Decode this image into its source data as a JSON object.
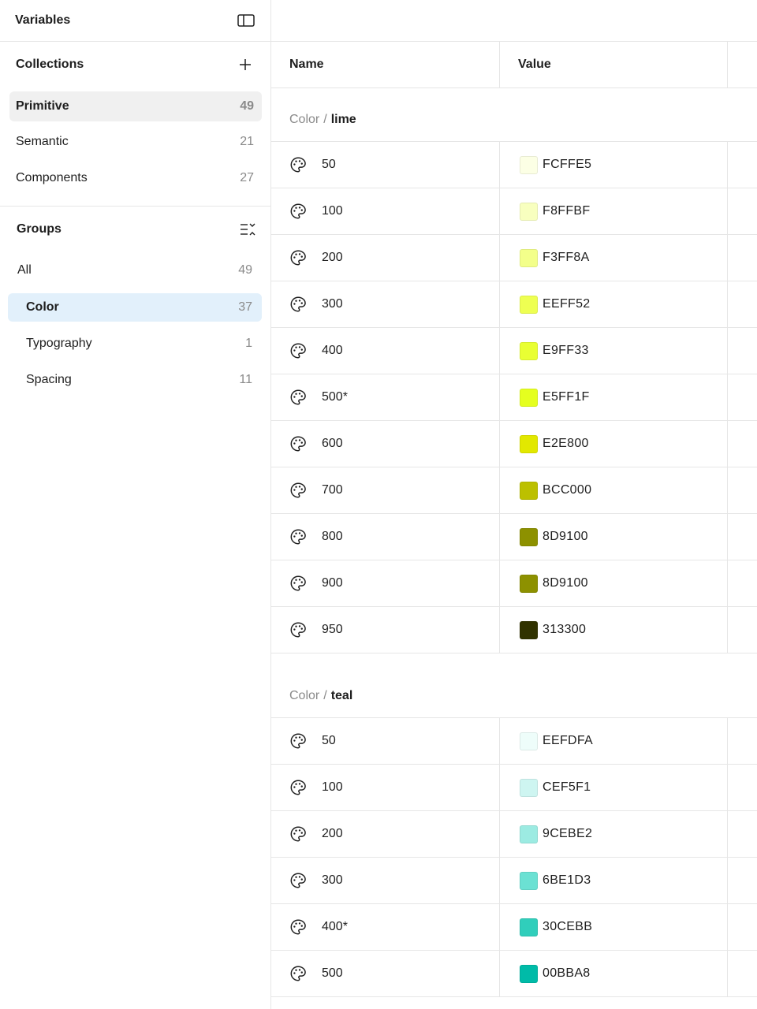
{
  "sidebar": {
    "title": "Variables",
    "collections": {
      "title": "Collections",
      "items": [
        {
          "label": "Primitive",
          "count": "49"
        },
        {
          "label": "Semantic",
          "count": "21"
        },
        {
          "label": "Components",
          "count": "27"
        }
      ]
    },
    "groups": {
      "title": "Groups",
      "items": [
        {
          "label": "All",
          "count": "49"
        },
        {
          "label": "Color",
          "count": "37"
        },
        {
          "label": "Typography",
          "count": "1"
        },
        {
          "label": "Spacing",
          "count": "11"
        }
      ]
    }
  },
  "table": {
    "headers": {
      "name": "Name",
      "value": "Value"
    },
    "groups": [
      {
        "prefix": "Color",
        "separator": "/",
        "name": "lime",
        "rows": [
          {
            "name": "50",
            "hex": "FCFFE5",
            "color": "#FCFFE5"
          },
          {
            "name": "100",
            "hex": "F8FFBF",
            "color": "#F8FFBF"
          },
          {
            "name": "200",
            "hex": "F3FF8A",
            "color": "#F3FF8A"
          },
          {
            "name": "300",
            "hex": "EEFF52",
            "color": "#EEFF52"
          },
          {
            "name": "400",
            "hex": "E9FF33",
            "color": "#E9FF33"
          },
          {
            "name": "500*",
            "hex": "E5FF1F",
            "color": "#E5FF1F"
          },
          {
            "name": "600",
            "hex": "E2E800",
            "color": "#E2E800"
          },
          {
            "name": "700",
            "hex": "BCC000",
            "color": "#BCC000"
          },
          {
            "name": "800",
            "hex": "8D9100",
            "color": "#8D9100"
          },
          {
            "name": "900",
            "hex": "8D9100",
            "color": "#8D9100"
          },
          {
            "name": "950",
            "hex": "313300",
            "color": "#313300"
          }
        ]
      },
      {
        "prefix": "Color",
        "separator": "/",
        "name": "teal",
        "rows": [
          {
            "name": "50",
            "hex": "EEFDFA",
            "color": "#EEFDFA"
          },
          {
            "name": "100",
            "hex": "CEF5F1",
            "color": "#CEF5F1"
          },
          {
            "name": "200",
            "hex": "9CEBE2",
            "color": "#9CEBE2"
          },
          {
            "name": "300",
            "hex": "6BE1D3",
            "color": "#6BE1D3"
          },
          {
            "name": "400*",
            "hex": "30CEBB",
            "color": "#30CEBB"
          },
          {
            "name": "500",
            "hex": "00BBA8",
            "color": "#00BBA8"
          }
        ]
      }
    ]
  },
  "icons": {
    "panel": "sidebar-toggle-icon",
    "add": "plus-icon",
    "group_list": "list-collapse-icon",
    "row": "palette-icon"
  }
}
